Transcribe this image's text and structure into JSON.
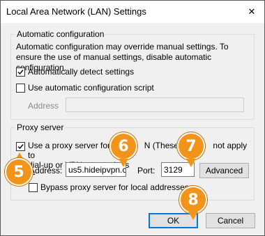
{
  "window": {
    "title": "Local Area Network (LAN) Settings",
    "close_glyph": "✕"
  },
  "automatic": {
    "legend": "Automatic configuration",
    "description": "Automatic configuration may override manual settings.  To ensure the use of manual settings, disable automatic configuration.",
    "detect": {
      "label": "Automatically detect settings",
      "checked": true
    },
    "script": {
      "label": "Use automatic configuration script",
      "checked": false
    },
    "address_label": "Address",
    "address_value": ""
  },
  "proxy": {
    "legend": "Proxy server",
    "use_proxy": {
      "label_line1": "Use a proxy server for you",
      "label_line1_end": "N (These setti",
      "label_line1_tail": "not apply to",
      "label_line2": "dial-up or VPN connections",
      "checked": true
    },
    "address_label": "Address:",
    "address_value": "us5.hideipvpn.com",
    "port_label": "Port:",
    "port_value": "3129",
    "advanced_label": "Advanced",
    "bypass": {
      "label": "Bypass proxy server for local addresses",
      "checked": false
    }
  },
  "buttons": {
    "ok": "OK",
    "cancel": "Cancel"
  },
  "markers": [
    "5",
    "6",
    "7",
    "8"
  ],
  "colors": {
    "marker": "#f19419",
    "ok_border": "#0078d7"
  }
}
